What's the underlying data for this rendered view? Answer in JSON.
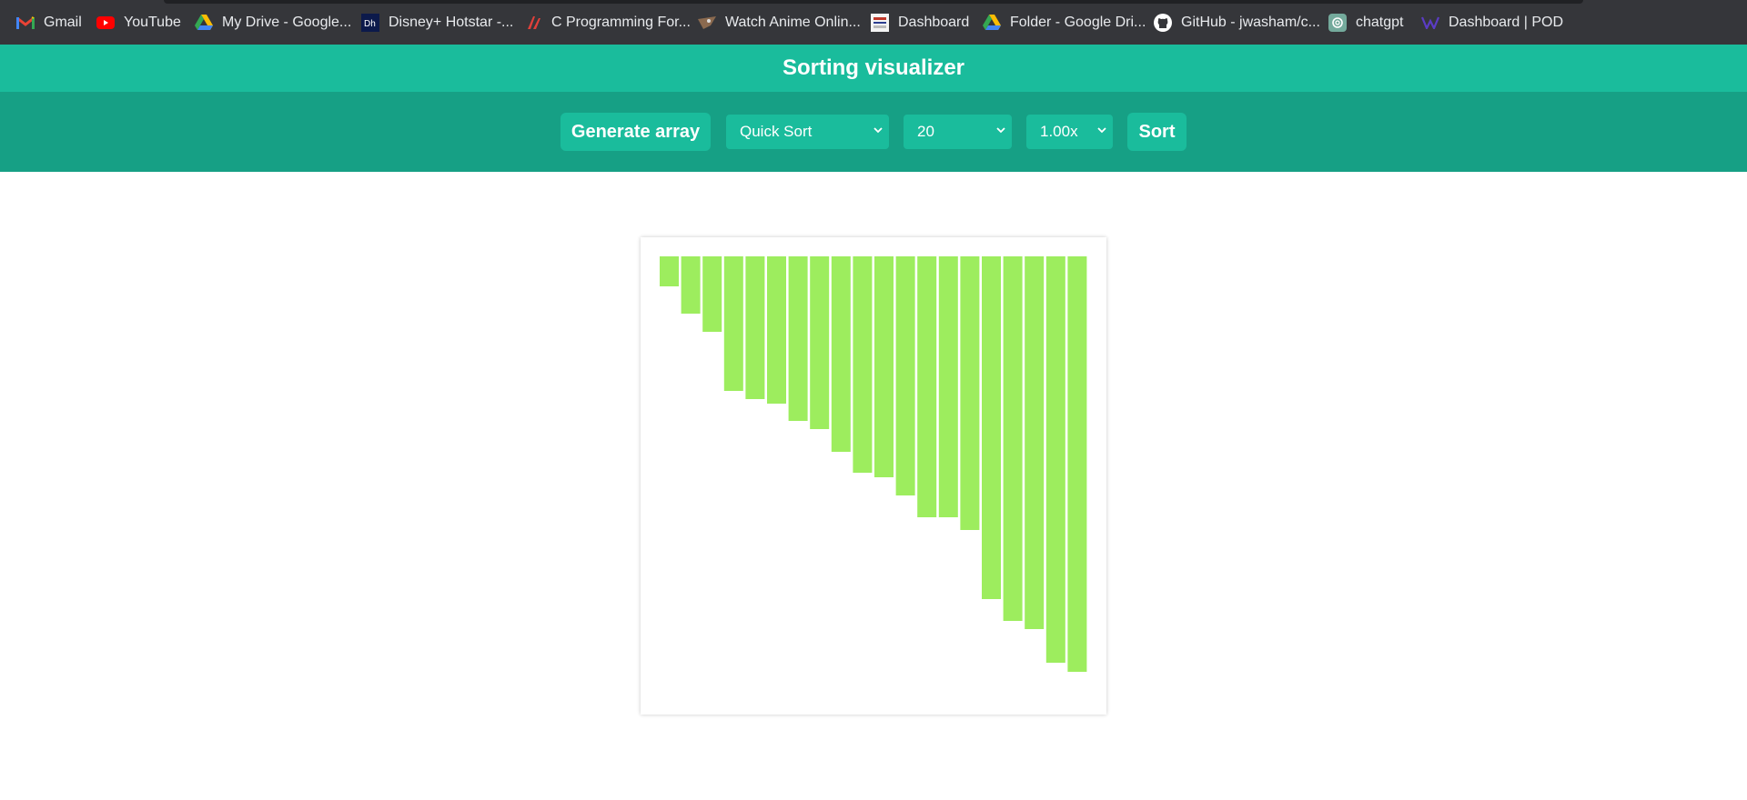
{
  "bookmarks": [
    {
      "label": "Gmail",
      "icon": "gmail-icon"
    },
    {
      "label": "YouTube",
      "icon": "youtube-icon"
    },
    {
      "label": "My Drive - Google...",
      "icon": "google-drive-icon"
    },
    {
      "label": "Disney+ Hotstar -...",
      "icon": "hotstar-icon"
    },
    {
      "label": "C Programming For...",
      "icon": "c-programming-icon"
    },
    {
      "label": "Watch Anime Onlin...",
      "icon": "anime-site-icon"
    },
    {
      "label": "Dashboard",
      "icon": "dashboard-site-icon"
    },
    {
      "label": "Folder - Google Dri...",
      "icon": "google-drive-icon"
    },
    {
      "label": "GitHub - jwasham/c...",
      "icon": "github-icon"
    },
    {
      "label": "chatgpt",
      "icon": "chatgpt-icon"
    },
    {
      "label": "Dashboard | POD",
      "icon": "pod-icon"
    }
  ],
  "header": {
    "title": "Sorting visualizer"
  },
  "controls": {
    "generate_label": "Generate array",
    "algorithm": "Quick Sort",
    "size": "20",
    "speed": "1.00x",
    "sort_label": "Sort"
  },
  "colors": {
    "header": "#1abc9c",
    "toolbar": "#16a085",
    "bar": "#9ded5e",
    "bookmarks_bg": "#35363a"
  },
  "chart_data": {
    "type": "bar",
    "orientation": "hanging from top",
    "values": [
      33,
      63,
      83,
      148,
      157,
      162,
      181,
      190,
      215,
      238,
      243,
      263,
      287,
      287,
      301,
      377,
      401,
      410,
      447,
      457
    ],
    "ylim": [
      0,
      457
    ]
  }
}
